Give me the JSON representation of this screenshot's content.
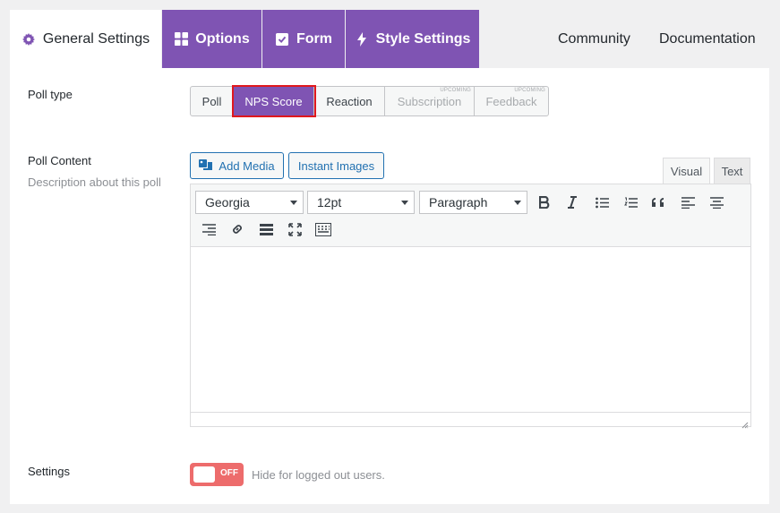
{
  "tabs": {
    "general": "General Settings",
    "options": "Options",
    "form": "Form",
    "style": "Style Settings",
    "community": "Community",
    "documentation": "Documentation"
  },
  "poll_type": {
    "label": "Poll type",
    "options": [
      "Poll",
      "NPS Score",
      "Reaction",
      "Subscription",
      "Feedback"
    ],
    "selected": "NPS Score",
    "badge": "UPCOMING"
  },
  "poll_content": {
    "label": "Poll Content",
    "description": "Description about this poll",
    "add_media": "Add Media",
    "instant_images": "Instant Images",
    "tab_visual": "Visual",
    "tab_text": "Text",
    "font_family": "Georgia",
    "font_size": "12pt",
    "block_format": "Paragraph"
  },
  "settings": {
    "label": "Settings",
    "toggle_state": "OFF",
    "hint": "Hide for logged out users."
  },
  "colors": {
    "accent": "#7f54b3",
    "highlight": "#e0181e",
    "toggle_off": "#ed6c6c",
    "link": "#2271b1"
  }
}
